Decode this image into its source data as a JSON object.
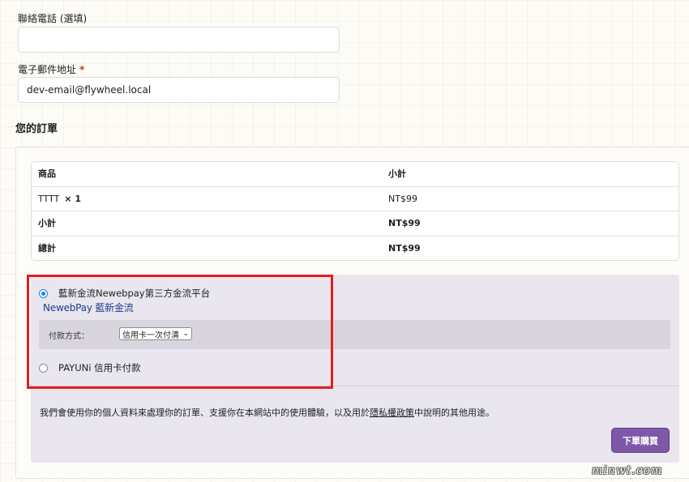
{
  "billing": {
    "phone_label": "聯絡電話 (選填)",
    "phone_value": "",
    "email_label": "電子郵件地址",
    "required_mark": "*",
    "email_value": "dev-email@flywheel.local"
  },
  "order": {
    "title": "您的訂單",
    "headers": [
      "商品",
      "小計"
    ],
    "items": [
      {
        "name": "TTTT",
        "qty": "× 1",
        "subtotal": "NT$99"
      }
    ],
    "subtotal_label": "小計",
    "subtotal_value": "NT$99",
    "total_label": "總計",
    "total_value": "NT$99"
  },
  "payment": {
    "methods": [
      {
        "label": "藍新金流Newebpay第三方金流平台",
        "selected": true
      },
      {
        "label": "PAYUNi 信用卡付款",
        "selected": false
      }
    ],
    "newebpay_logo": "NewebPay 藍新金流",
    "method_field_label": "付款方式：",
    "method_selected": "信用卡一次付清",
    "privacy_before": "我們會使用你的個人資料來處理你的訂單、支援你在本網站中的使用體驗，以及用於",
    "privacy_link": "隱私權政策",
    "privacy_after": "中說明的其他用途。",
    "place_order_label": "下單購買"
  },
  "colors": {
    "accent_button": "#7e57a8",
    "highlight_border": "#e41e1e",
    "radio_checked": "#1e7ff0"
  },
  "watermark": "minwt.com"
}
